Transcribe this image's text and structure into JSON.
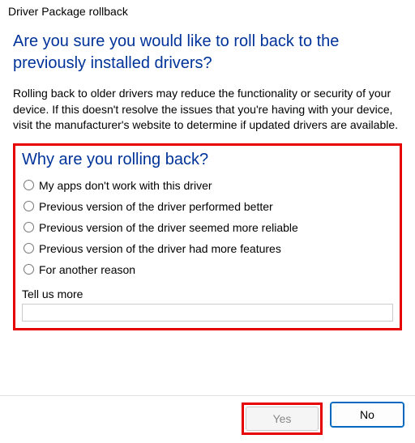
{
  "titlebar": "Driver Package rollback",
  "heading": "Are you sure you would like to roll back to the previously installed drivers?",
  "body": "Rolling back to older drivers may reduce the functionality or security of your device. If this doesn't resolve the issues that you're having with your device, visit the manufacturer's website to determine if updated drivers are available.",
  "subheading": "Why are you rolling back?",
  "radios": [
    "My apps don't work with this driver",
    "Previous version of the driver performed better",
    "Previous version of the driver seemed more reliable",
    "Previous version of the driver had more features",
    "For another reason"
  ],
  "tellus_label": "Tell us more",
  "tellus_value": "",
  "buttons": {
    "yes": "Yes",
    "no": "No"
  },
  "highlight_color": "#e60000",
  "accent_color": "#003399"
}
